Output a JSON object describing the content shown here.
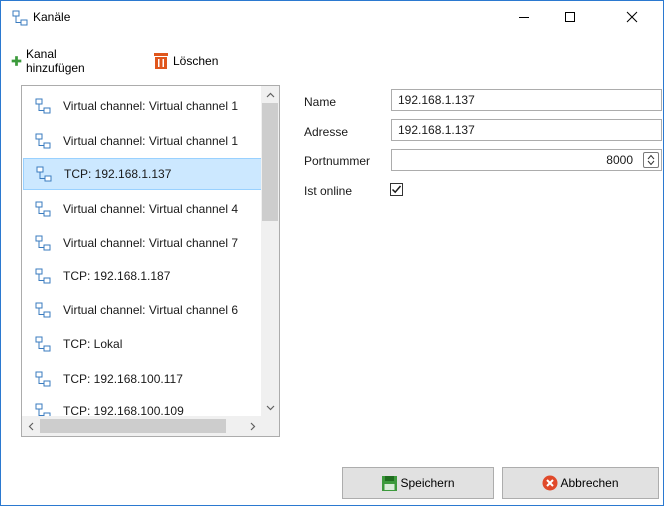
{
  "window": {
    "title": "Kanäle",
    "controls": {
      "minimize": "—",
      "maximize": "☐",
      "close": "✕"
    }
  },
  "toolbar": {
    "add_label": "Kanal hinzufügen",
    "delete_label": "Löschen"
  },
  "channels": {
    "items": [
      {
        "label": "Virtual channel: Virtual channel 1",
        "selected": false
      },
      {
        "label": "Virtual channel: Virtual channel 1",
        "selected": false
      },
      {
        "label": "TCP: 192.168.1.137",
        "selected": true
      },
      {
        "label": "Virtual channel: Virtual channel 4",
        "selected": false
      },
      {
        "label": "Virtual channel: Virtual channel 7",
        "selected": false
      },
      {
        "label": "TCP: 192.168.1.187",
        "selected": false
      },
      {
        "label": "Virtual channel: Virtual channel 6",
        "selected": false
      },
      {
        "label": "TCP: Lokal",
        "selected": false
      },
      {
        "label": "TCP: 192.168.100.117",
        "selected": false
      },
      {
        "label": "TCP: 192.168.100.109",
        "selected": false
      }
    ]
  },
  "form": {
    "name_label": "Name",
    "name_value": "192.168.1.137",
    "address_label": "Adresse",
    "address_value": "192.168.1.137",
    "port_label": "Portnummer",
    "port_value": "8000",
    "online_label": "Ist online",
    "online_checked": true
  },
  "buttons": {
    "save_label": "Speichern",
    "cancel_label": "Abbrechen"
  },
  "colors": {
    "selection_bg": "#cce8ff",
    "selection_border": "#99d1ff",
    "window_border": "#2b79d0",
    "add_icon": "#3c9a3c",
    "delete_icon": "#e0561c",
    "cancel_icon": "#e0492a",
    "save_icon": "#3c9a3c"
  },
  "icons": {
    "title": "network-icon",
    "channel": "network-icon",
    "add": "plus-icon",
    "delete": "trash-icon",
    "save": "floppy-icon",
    "cancel": "cancel-circle-icon"
  }
}
